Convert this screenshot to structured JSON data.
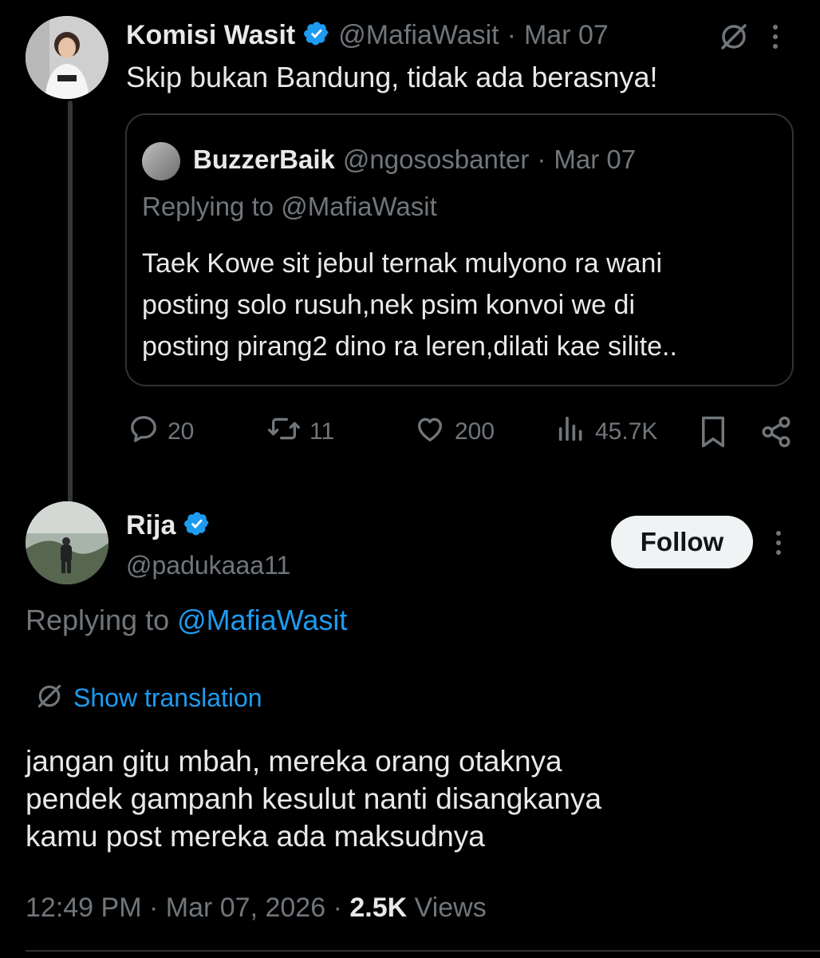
{
  "tweet": {
    "author_name": "Komisi Wasit",
    "handle": "@MafiaWasit",
    "date": "Mar 07",
    "separator": "·",
    "text": "Skip bukan Bandung, tidak ada berasnya!",
    "quote": {
      "author_name": "BuzzerBaik",
      "handle": "@ngososbanter",
      "date": "Mar 07",
      "replying_prefix": "Replying to",
      "replying_handle": "@MafiaWasit",
      "text_lines": [
        "Taek Kowe sit jebul ternak mulyono ra wani",
        "posting solo rusuh,nek psim konvoi we di",
        "posting pirang2 dino ra leren,dilati kae silite.."
      ]
    },
    "actions": {
      "replies": "20",
      "reposts": "11",
      "likes": "200",
      "views": "45.7K"
    }
  },
  "reply": {
    "author_name": "Rija",
    "handle": "@padukaaa11",
    "follow_label": "Follow",
    "replying_prefix": "Replying to",
    "replying_handle": "@MafiaWasit",
    "show_translation": "Show translation",
    "text_lines": [
      "jangan gitu mbah, mereka orang otaknya",
      "pendek gampanh kesulut nanti disangkanya",
      "kamu post mereka ada maksudnya"
    ],
    "time": "12:49 PM",
    "full_date": "Mar 07, 2026",
    "views_count": "2.5K",
    "views_label": "Views"
  },
  "colors": {
    "background": "#000000",
    "text": "#e7e9ea",
    "muted": "#71767b",
    "accent": "#1d9bf0",
    "border": "#2f3336"
  },
  "icons": [
    "verified-badge-icon",
    "no-translate-icon",
    "more-icon",
    "reply-icon",
    "repost-icon",
    "like-icon",
    "views-icon",
    "bookmark-icon",
    "share-icon"
  ]
}
